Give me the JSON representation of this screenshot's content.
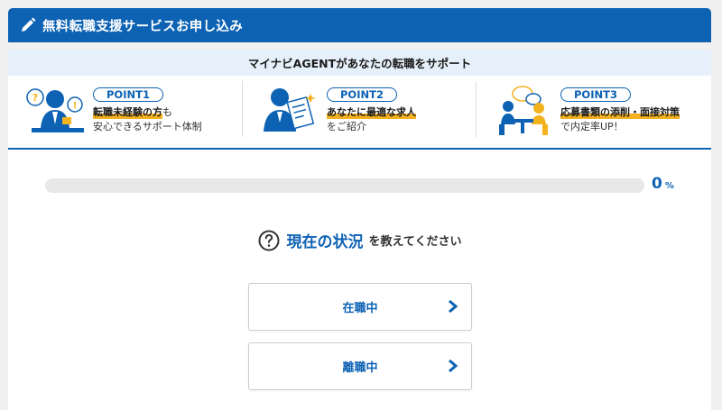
{
  "header": {
    "title": "無料転職支援サービスお申し込み"
  },
  "points": {
    "banner": "マイナビAGENTがあなたの転職をサポート",
    "items": [
      {
        "badge": "POINT1",
        "highlight": "転職未経験の方",
        "highlight_suffix": "も",
        "sub": "安心できるサポート体制",
        "icon": "advisor-icon"
      },
      {
        "badge": "POINT2",
        "highlight": "あなたに最適な求人",
        "highlight_suffix": "",
        "sub": "をご紹介",
        "icon": "job-document-icon"
      },
      {
        "badge": "POINT3",
        "highlight": "応募書類の添削・面接対策",
        "highlight_suffix": "",
        "sub": "で内定率UP！",
        "icon": "interview-icon"
      }
    ]
  },
  "progress": {
    "value": 0,
    "number": "0",
    "unit": "%"
  },
  "question": {
    "strong": "現在の状況",
    "rest": "を教えてください"
  },
  "choices": [
    {
      "label": "在職中"
    },
    {
      "label": "離職中"
    }
  ],
  "colors": {
    "brand": "#0d62b3",
    "highlight": "#f5b21f",
    "banner_bg": "#e6f0fa"
  }
}
